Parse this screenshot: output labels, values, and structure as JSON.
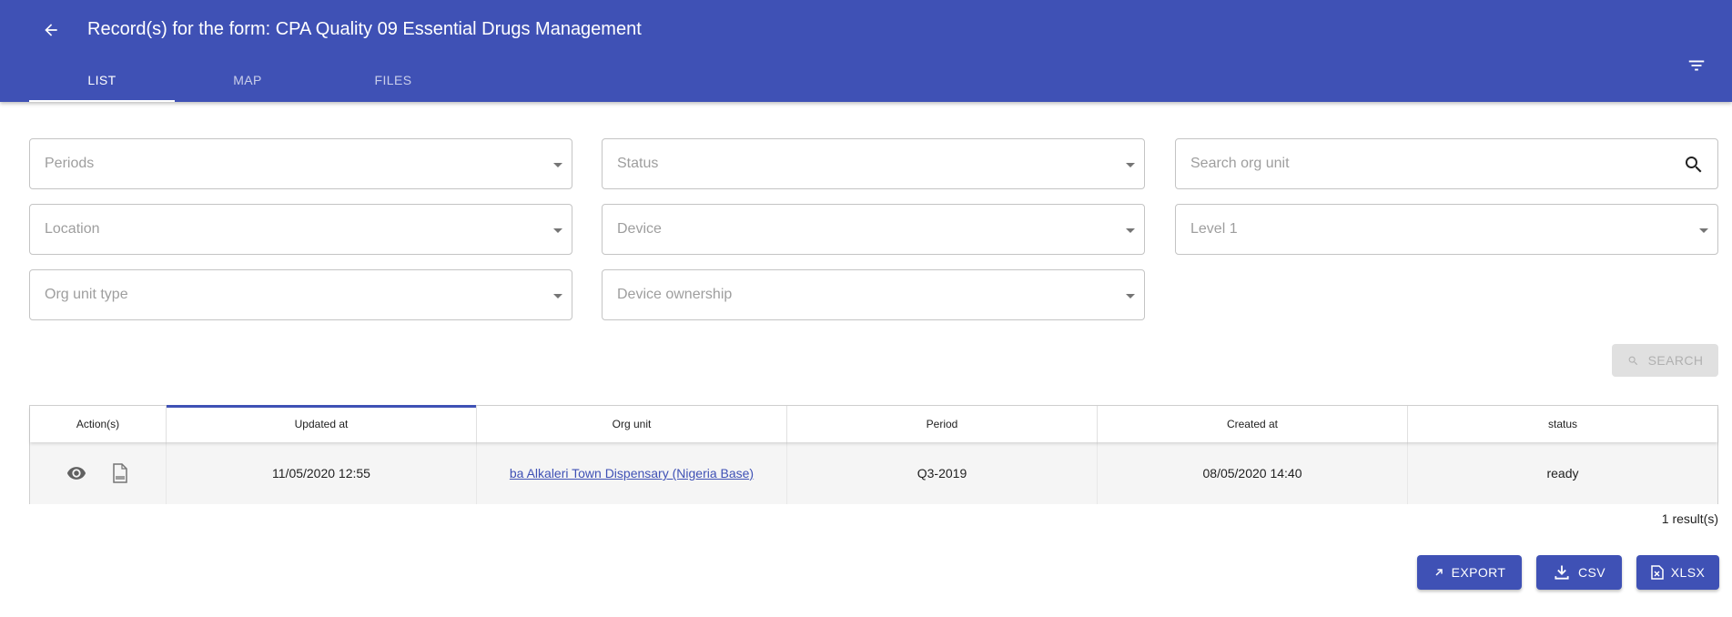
{
  "header": {
    "title": "Record(s) for the form: CPA Quality 09 Essential Drugs Management",
    "back_icon": "arrow-left-icon",
    "filter_icon": "filter-list-icon",
    "background": "#3f51b5"
  },
  "tabs": [
    {
      "label": "LIST",
      "active": true
    },
    {
      "label": "MAP",
      "active": false
    },
    {
      "label": "FILES",
      "active": false
    }
  ],
  "filters": {
    "periods": {
      "placeholder": "Periods"
    },
    "status": {
      "placeholder": "Status"
    },
    "search_org_unit": {
      "placeholder": "Search org unit"
    },
    "location": {
      "placeholder": "Location"
    },
    "device": {
      "placeholder": "Device"
    },
    "level_1": {
      "placeholder": "Level 1"
    },
    "org_unit_type": {
      "placeholder": "Org unit type"
    },
    "device_ownership": {
      "placeholder": "Device ownership"
    }
  },
  "search_button": {
    "label": "SEARCH",
    "disabled": true
  },
  "table": {
    "columns": [
      "Action(s)",
      "Updated at",
      "Org unit",
      "Period",
      "Created at",
      "status"
    ],
    "sorted_column": "Updated at",
    "rows": [
      {
        "action_icons": [
          "eye-icon",
          "xml-file-icon"
        ],
        "updated_at": "11/05/2020 12:55",
        "org_unit": "ba Alkaleri Town Dispensary (Nigeria Base)",
        "period": "Q3-2019",
        "created_at": "08/05/2020 14:40",
        "status": "ready"
      }
    ]
  },
  "results_count": "1 result(s)",
  "export_buttons": {
    "export": "EXPORT",
    "csv": "CSV",
    "xlsx": "XLSX"
  },
  "colors": {
    "primary": "#3f51b5",
    "disabled": "#e0e0e0"
  }
}
